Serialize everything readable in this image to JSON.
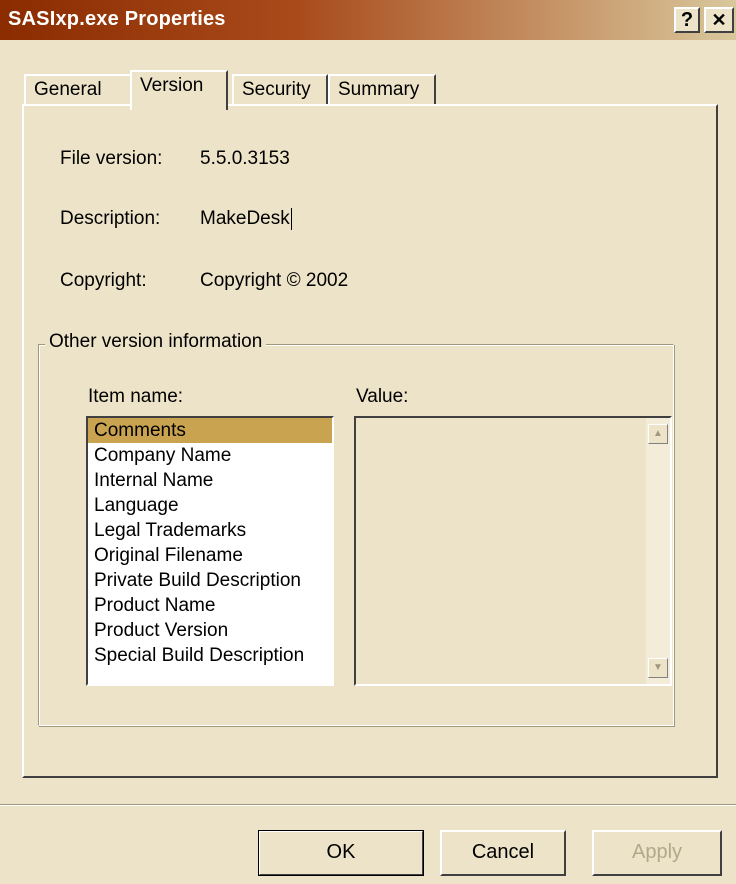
{
  "window": {
    "title": "SASIxp.exe Properties",
    "help_button": "?",
    "close_button": "✕"
  },
  "tabs": [
    {
      "label": "General",
      "active": false
    },
    {
      "label": "Version",
      "active": true
    },
    {
      "label": "Security",
      "active": false
    },
    {
      "label": "Summary",
      "active": false
    }
  ],
  "version": {
    "file_version_label": "File version:",
    "file_version_value": "5.5.0.3153",
    "description_label": "Description:",
    "description_value": "MakeDesk",
    "copyright_label": "Copyright:",
    "copyright_value": "Copyright © 2002"
  },
  "other_info": {
    "group_title": "Other version information",
    "item_name_label": "Item name:",
    "value_label": "Value:",
    "items": [
      "Comments",
      "Company Name",
      "Internal Name",
      "Language",
      "Legal Trademarks",
      "Original Filename",
      "Private Build Description",
      "Product Name",
      "Product Version",
      "Special Build Description"
    ],
    "selected_item": "Comments",
    "value_text": ""
  },
  "buttons": {
    "ok": "OK",
    "cancel": "Cancel",
    "apply": "Apply"
  },
  "colors": {
    "face": "#ede3c8",
    "title_start": "#8a2c00",
    "selection": "#c9a350"
  }
}
